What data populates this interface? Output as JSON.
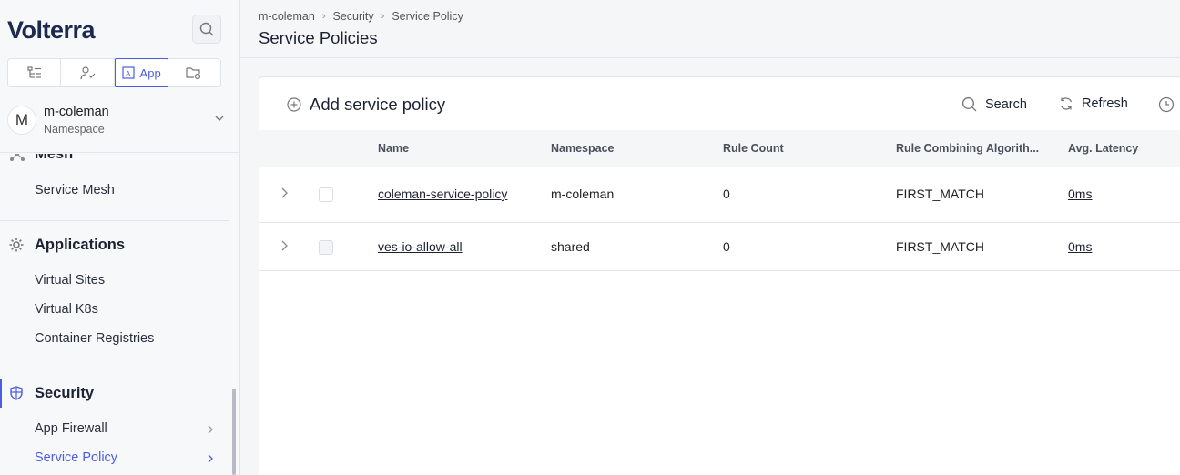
{
  "sidebar": {
    "logo": "Volterra",
    "tabs": [
      {
        "icon": "tree-icon",
        "label": ""
      },
      {
        "icon": "users-icon",
        "label": ""
      },
      {
        "icon": "app-icon",
        "label": "App"
      },
      {
        "icon": "folder-settings-icon",
        "label": ""
      }
    ],
    "namespace": {
      "avatar": "M",
      "name": "m-coleman",
      "sub": "Namespace"
    },
    "groups": [
      {
        "title": "Mesh",
        "icon": "mesh-icon",
        "items": [
          "Service Mesh"
        ]
      },
      {
        "title": "Applications",
        "icon": "gear-icon",
        "items": [
          "Virtual Sites",
          "Virtual K8s",
          "Container Registries"
        ]
      },
      {
        "title": "Security",
        "icon": "shield-icon",
        "items": [
          "App Firewall",
          "Service Policy"
        ]
      }
    ]
  },
  "header": {
    "breadcrumb": [
      "m-coleman",
      "Security",
      "Service Policy"
    ],
    "title": "Service Policies"
  },
  "toolbar": {
    "add_label": "Add service policy",
    "search_label": "Search",
    "refresh_label": "Refresh"
  },
  "table": {
    "columns": [
      "Name",
      "Namespace",
      "Rule Count",
      "Rule Combining Algorith...",
      "Avg. Latency"
    ],
    "rows": [
      {
        "name": "coleman-service-policy",
        "namespace": "m-coleman",
        "rule_count": "0",
        "algorithm": "FIRST_MATCH",
        "latency": "0ms"
      },
      {
        "name": "ves-io-allow-all",
        "namespace": "shared",
        "rule_count": "0",
        "algorithm": "FIRST_MATCH",
        "latency": "0ms"
      }
    ]
  },
  "colors": {
    "accent": "#4a5de0",
    "brand": "#1b2a4e"
  }
}
